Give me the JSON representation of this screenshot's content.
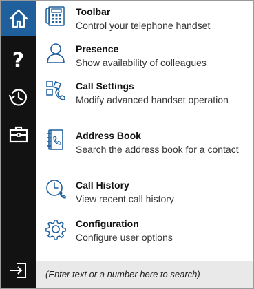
{
  "rail": {
    "items": [
      {
        "icon": "home-icon"
      },
      {
        "icon": "help-icon",
        "glyph": "?"
      },
      {
        "icon": "history-icon"
      },
      {
        "icon": "briefcase-icon"
      },
      {
        "icon": "sign-in-icon"
      }
    ]
  },
  "menu": {
    "items": [
      {
        "icon": "telephone-icon",
        "title": "Toolbar",
        "description": "Control your telephone handset"
      },
      {
        "icon": "person-icon",
        "title": "Presence",
        "description": "Show availability of colleagues"
      },
      {
        "icon": "call-settings-icon",
        "title": "Call Settings",
        "description": "Modify advanced handset operation"
      },
      {
        "icon": "address-book-icon",
        "title": "Address Book",
        "description": "Search the address book for a contact"
      },
      {
        "icon": "call-history-icon",
        "title": "Call History",
        "description": "View recent call history"
      },
      {
        "icon": "gear-icon",
        "title": "Configuration",
        "description": "Configure user options"
      }
    ]
  },
  "search": {
    "placeholder": "(Enter text or a number here to search)"
  },
  "colors": {
    "accent": "#1f5f9c",
    "rail": "#121212",
    "search_bg": "#e9e9e9"
  }
}
